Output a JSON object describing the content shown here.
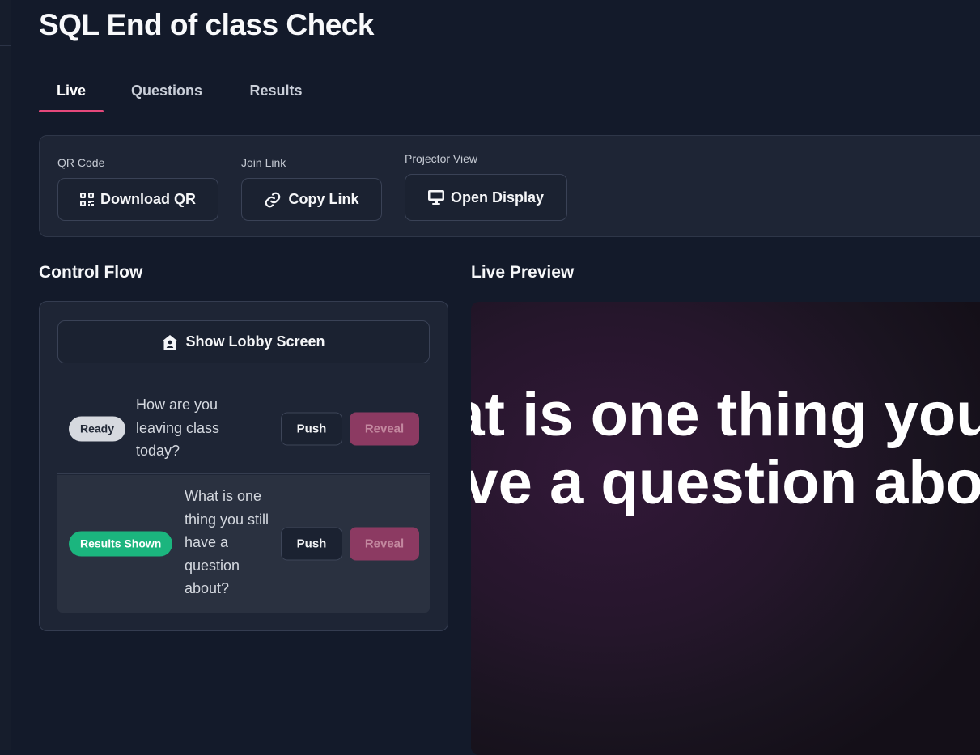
{
  "page": {
    "title": "SQL End of class Check"
  },
  "tabs": [
    {
      "label": "Live",
      "active": true
    },
    {
      "label": "Questions",
      "active": false
    },
    {
      "label": "Results",
      "active": false
    }
  ],
  "share": {
    "qr": {
      "label": "QR Code",
      "button": "Download QR",
      "icon": "qr-code-icon"
    },
    "link": {
      "label": "Join Link",
      "button": "Copy Link",
      "icon": "link-icon"
    },
    "projector": {
      "label": "Projector View",
      "button": "Open Display",
      "icon": "monitor-icon"
    }
  },
  "control_flow": {
    "title": "Control Flow",
    "lobby_button": "Show Lobby Screen",
    "lobby_icon": "home-icon",
    "questions": [
      {
        "status": "Ready",
        "status_color": "#d6d9df",
        "text": "How are you leaving class today?",
        "push": "Push",
        "reveal": "Reveal"
      },
      {
        "status": "Results Shown",
        "status_color": "#1bb57e",
        "text": "What is one thing you still have a question about?",
        "push": "Push",
        "reveal": "Reveal"
      }
    ]
  },
  "preview": {
    "title": "Live Preview",
    "text": "What is one thing you still have a question about?"
  },
  "colors": {
    "accent": "#e5487b",
    "reveal": "#8c3a62",
    "success": "#1bb57e",
    "background": "#131a2a"
  }
}
